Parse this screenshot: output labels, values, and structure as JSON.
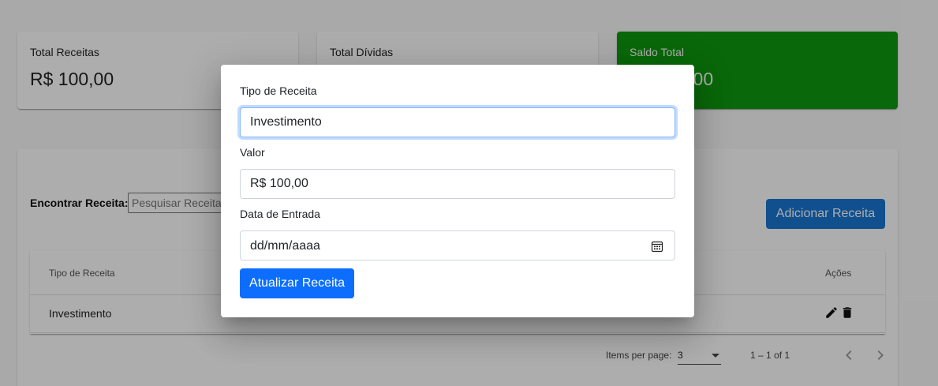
{
  "summary": {
    "receitas": {
      "title": "Total Receitas",
      "value": "R$ 100,00"
    },
    "dividas": {
      "title": "Total Dívidas",
      "value": ""
    },
    "saldo": {
      "title": "Saldo Total",
      "value": "R$ 100,00",
      "color": "#0e9a0e"
    }
  },
  "search": {
    "label": "Encontrar Receita:",
    "placeholder": "Pesquisar Receita"
  },
  "add_button": "Adicionar Receita",
  "table": {
    "columns": [
      "Tipo de Receita",
      "Ações"
    ],
    "rows": [
      {
        "tipo": "Investimento"
      }
    ]
  },
  "paginator": {
    "items_label": "Items per page:",
    "page_size": "3",
    "range": "1 – 1 of 1"
  },
  "dialog": {
    "tipo_label": "Tipo de Receita",
    "tipo_value": "Investimento",
    "valor_label": "Valor",
    "valor_value": "R$ 100,00",
    "data_label": "Data de Entrada",
    "data_placeholder": "dd/mm/aaaa",
    "submit": "Atualizar Receita"
  },
  "icons": {
    "edit": "pencil-icon",
    "delete": "trash-icon",
    "calendar": "calendar-icon",
    "prev": "chevron-left-icon",
    "next": "chevron-right-icon"
  },
  "colors": {
    "primary": "#1976d2",
    "bootstrap_primary": "#0d6efd",
    "saldo_green": "#0e9a0e"
  }
}
